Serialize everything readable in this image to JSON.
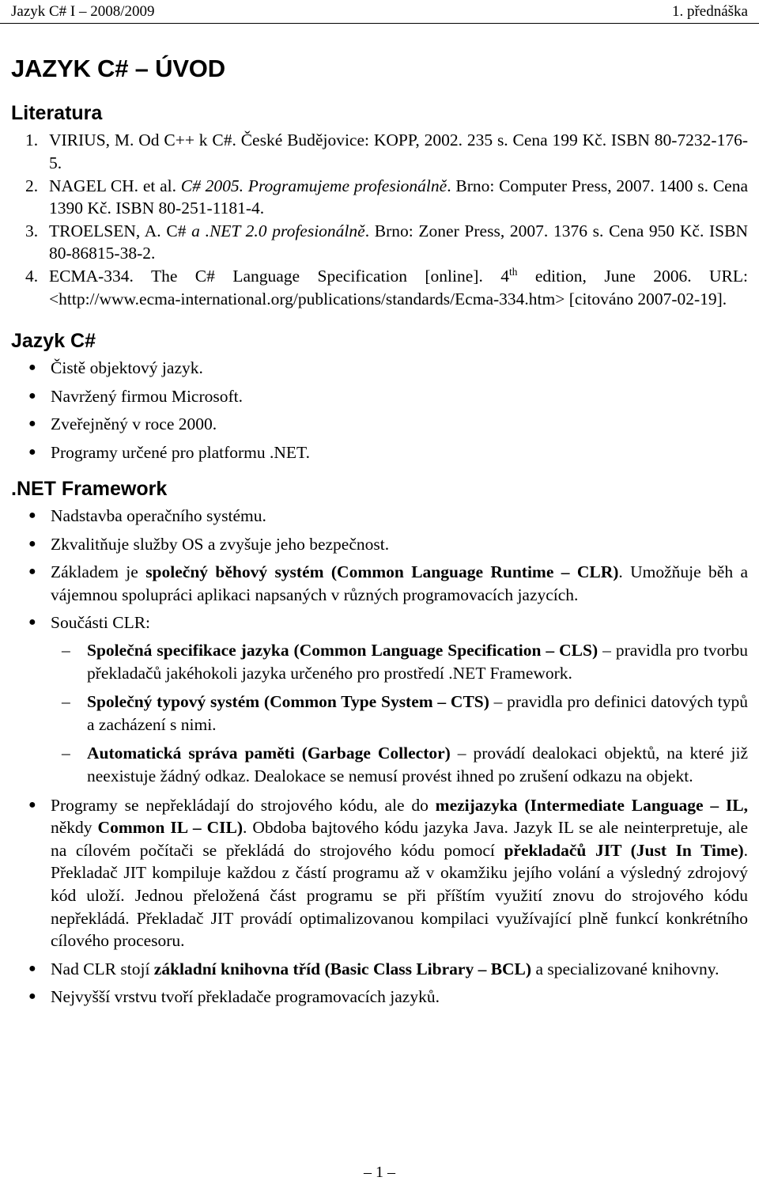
{
  "header": {
    "left": "Jazyk C# I – 2008/2009",
    "right": "1. přednáška"
  },
  "title": "JAZYK C# – ÚVOD",
  "sections": {
    "literature": {
      "heading": "Literatura",
      "items": [
        {
          "num": "1.",
          "parts": [
            {
              "text": "VIRIUS, M. Od C++ k C#. České Budějovice: KOPP, 2002. 235 s. Cena 199 Kč. ISBN 80-7232-176-5.",
              "style": "normal"
            }
          ]
        },
        {
          "num": "2.",
          "parts": [
            {
              "text": "NAGEL CH. et al. ",
              "style": "normal"
            },
            {
              "text": "C# 2005. Programujeme profesionálně",
              "style": "italic"
            },
            {
              "text": ". Brno: Computer Press, 2007. 1400 s. Cena 1390 Kč. ISBN 80-251-1181-4.",
              "style": "normal"
            }
          ]
        },
        {
          "num": "3.",
          "parts": [
            {
              "text": "TROELSEN, A. C# ",
              "style": "normal"
            },
            {
              "text": "a .NET 2.0 profesionálně",
              "style": "italic"
            },
            {
              "text": ". Brno: Zoner Press, 2007. 1376 s. Cena 950 Kč. ISBN 80-86815-38-2.",
              "style": "normal"
            }
          ]
        },
        {
          "num": "4.",
          "parts": [
            {
              "text": "ECMA-334. The C# Language Specification [online]. 4",
              "style": "normal"
            },
            {
              "text": "th",
              "style": "sup"
            },
            {
              "text": " edition, June 2006. URL: <http://www.ecma-international.org/publications/standards/Ecma-334.htm> [citováno 2007-02-19].",
              "style": "normal"
            }
          ]
        }
      ]
    },
    "jazyk_csharp": {
      "heading": "Jazyk C#",
      "bullets": [
        {
          "parts": [
            {
              "text": "Čistě objektový jazyk.",
              "style": "normal"
            }
          ]
        },
        {
          "parts": [
            {
              "text": "Navržený firmou Microsoft.",
              "style": "normal"
            }
          ]
        },
        {
          "parts": [
            {
              "text": "Zveřejněný v roce 2000.",
              "style": "normal"
            }
          ]
        },
        {
          "parts": [
            {
              "text": "Programy určené pro platformu .NET.",
              "style": "normal"
            }
          ]
        }
      ]
    },
    "net_framework": {
      "heading": ".NET Framework",
      "bullets": [
        {
          "parts": [
            {
              "text": "Nadstavba operačního systému.",
              "style": "normal"
            }
          ]
        },
        {
          "parts": [
            {
              "text": "Zkvalitňuje služby OS a zvyšuje jeho bezpečnost.",
              "style": "normal"
            }
          ]
        },
        {
          "parts": [
            {
              "text": "Základem je ",
              "style": "normal"
            },
            {
              "text": "společný běhový systém (Common Language Runtime – CLR)",
              "style": "bold"
            },
            {
              "text": ". Umožňuje běh a vájemnou spolupráci aplikaci napsaných v různých programovacích jazycích.",
              "style": "normal"
            }
          ]
        },
        {
          "parts": [
            {
              "text": "Součásti CLR:",
              "style": "normal"
            }
          ],
          "sub": [
            {
              "parts": [
                {
                  "text": "Společná specifikace jazyka (Common Language Specification – CLS)",
                  "style": "bold"
                },
                {
                  "text": " – pravidla pro tvorbu překladačů jakéhokoli jazyka určeného pro prostředí .NET Framework.",
                  "style": "normal"
                }
              ]
            },
            {
              "parts": [
                {
                  "text": "Společný typový systém (Common Type System – CTS)",
                  "style": "bold"
                },
                {
                  "text": " – pravidla pro definici datových typů a zacházení s nimi.",
                  "style": "normal"
                }
              ]
            },
            {
              "parts": [
                {
                  "text": "Automatická správa paměti (Garbage Collector)",
                  "style": "bold"
                },
                {
                  "text": " – provádí dealokaci objektů, na které již neexistuje žádný odkaz. Dealokace se nemusí provést ihned po zrušení odkazu na objekt.",
                  "style": "normal"
                }
              ]
            }
          ]
        },
        {
          "parts": [
            {
              "text": "Programy se nepřekládají do strojového kódu, ale do ",
              "style": "normal"
            },
            {
              "text": "mezijazyka (Intermediate Language – IL,",
              "style": "bold"
            },
            {
              "text": " někdy ",
              "style": "normal"
            },
            {
              "text": "Common IL – CIL)",
              "style": "bold"
            },
            {
              "text": ". Obdoba bajtového kódu jazyka Java. Jazyk IL se ale neinterpretuje, ale na cílovém počítači se překládá do strojového kódu pomocí ",
              "style": "normal"
            },
            {
              "text": "překladačů JIT (Just In Time)",
              "style": "bold"
            },
            {
              "text": ". Překladač JIT kompiluje každou z částí programu až v okamžiku jejího volání a výsledný zdrojový kód uloží. Jednou přeložená část programu se při příštím využití znovu do strojového kódu nepřekládá. Překladač JIT provádí optimalizovanou kompilaci využívající plně funkcí konkrétního cílového procesoru.",
              "style": "normal"
            }
          ]
        },
        {
          "parts": [
            {
              "text": "Nad CLR stojí ",
              "style": "normal"
            },
            {
              "text": "základní knihovna tříd (Basic Class Library – BCL)",
              "style": "bold"
            },
            {
              "text": " a specializované knihovny.",
              "style": "normal"
            }
          ]
        },
        {
          "parts": [
            {
              "text": "Nejvyšší vrstvu tvoří překladače programovacích jazyků.",
              "style": "normal"
            }
          ]
        }
      ]
    }
  },
  "footer": "– 1 –",
  "bullet_glyph": "●",
  "dash_glyph": "–"
}
